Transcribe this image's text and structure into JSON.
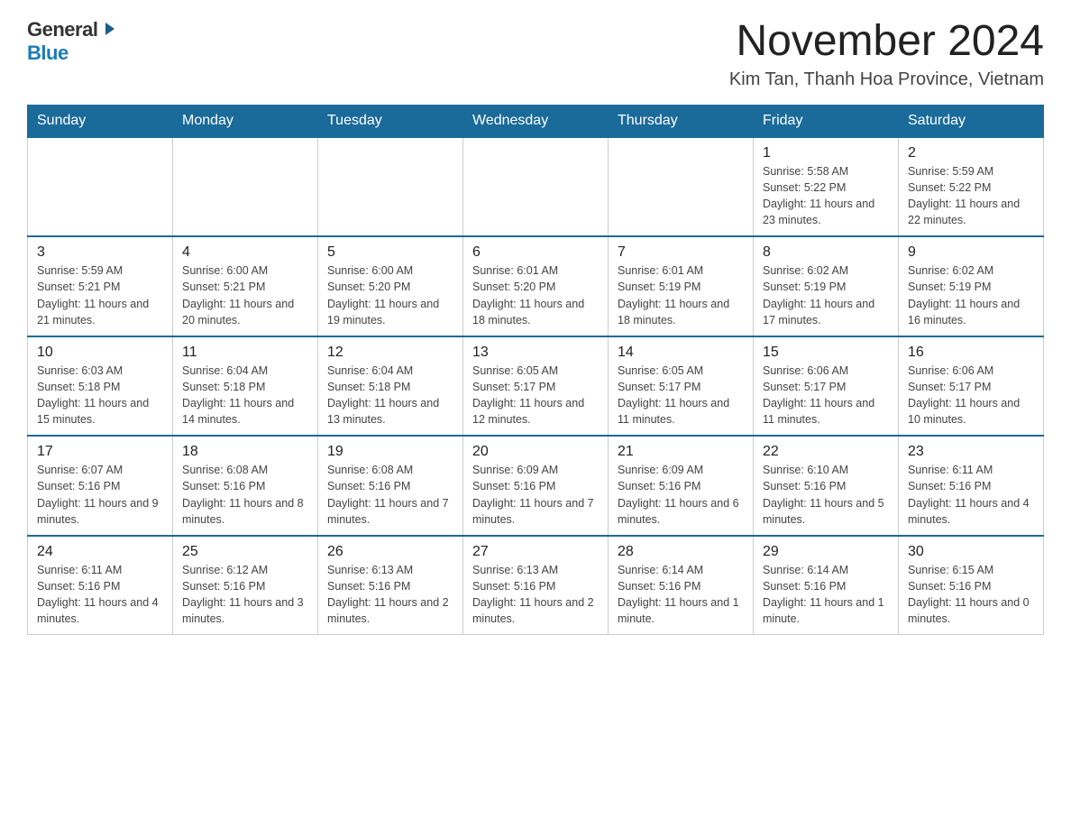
{
  "header": {
    "month_title": "November 2024",
    "location": "Kim Tan, Thanh Hoa Province, Vietnam",
    "logo_general": "General",
    "logo_blue": "Blue"
  },
  "calendar": {
    "days_of_week": [
      "Sunday",
      "Monday",
      "Tuesday",
      "Wednesday",
      "Thursday",
      "Friday",
      "Saturday"
    ],
    "weeks": [
      {
        "days": [
          {
            "num": "",
            "info": ""
          },
          {
            "num": "",
            "info": ""
          },
          {
            "num": "",
            "info": ""
          },
          {
            "num": "",
            "info": ""
          },
          {
            "num": "",
            "info": ""
          },
          {
            "num": "1",
            "info": "Sunrise: 5:58 AM\nSunset: 5:22 PM\nDaylight: 11 hours and 23 minutes."
          },
          {
            "num": "2",
            "info": "Sunrise: 5:59 AM\nSunset: 5:22 PM\nDaylight: 11 hours and 22 minutes."
          }
        ]
      },
      {
        "days": [
          {
            "num": "3",
            "info": "Sunrise: 5:59 AM\nSunset: 5:21 PM\nDaylight: 11 hours and 21 minutes."
          },
          {
            "num": "4",
            "info": "Sunrise: 6:00 AM\nSunset: 5:21 PM\nDaylight: 11 hours and 20 minutes."
          },
          {
            "num": "5",
            "info": "Sunrise: 6:00 AM\nSunset: 5:20 PM\nDaylight: 11 hours and 19 minutes."
          },
          {
            "num": "6",
            "info": "Sunrise: 6:01 AM\nSunset: 5:20 PM\nDaylight: 11 hours and 18 minutes."
          },
          {
            "num": "7",
            "info": "Sunrise: 6:01 AM\nSunset: 5:19 PM\nDaylight: 11 hours and 18 minutes."
          },
          {
            "num": "8",
            "info": "Sunrise: 6:02 AM\nSunset: 5:19 PM\nDaylight: 11 hours and 17 minutes."
          },
          {
            "num": "9",
            "info": "Sunrise: 6:02 AM\nSunset: 5:19 PM\nDaylight: 11 hours and 16 minutes."
          }
        ]
      },
      {
        "days": [
          {
            "num": "10",
            "info": "Sunrise: 6:03 AM\nSunset: 5:18 PM\nDaylight: 11 hours and 15 minutes."
          },
          {
            "num": "11",
            "info": "Sunrise: 6:04 AM\nSunset: 5:18 PM\nDaylight: 11 hours and 14 minutes."
          },
          {
            "num": "12",
            "info": "Sunrise: 6:04 AM\nSunset: 5:18 PM\nDaylight: 11 hours and 13 minutes."
          },
          {
            "num": "13",
            "info": "Sunrise: 6:05 AM\nSunset: 5:17 PM\nDaylight: 11 hours and 12 minutes."
          },
          {
            "num": "14",
            "info": "Sunrise: 6:05 AM\nSunset: 5:17 PM\nDaylight: 11 hours and 11 minutes."
          },
          {
            "num": "15",
            "info": "Sunrise: 6:06 AM\nSunset: 5:17 PM\nDaylight: 11 hours and 11 minutes."
          },
          {
            "num": "16",
            "info": "Sunrise: 6:06 AM\nSunset: 5:17 PM\nDaylight: 11 hours and 10 minutes."
          }
        ]
      },
      {
        "days": [
          {
            "num": "17",
            "info": "Sunrise: 6:07 AM\nSunset: 5:16 PM\nDaylight: 11 hours and 9 minutes."
          },
          {
            "num": "18",
            "info": "Sunrise: 6:08 AM\nSunset: 5:16 PM\nDaylight: 11 hours and 8 minutes."
          },
          {
            "num": "19",
            "info": "Sunrise: 6:08 AM\nSunset: 5:16 PM\nDaylight: 11 hours and 7 minutes."
          },
          {
            "num": "20",
            "info": "Sunrise: 6:09 AM\nSunset: 5:16 PM\nDaylight: 11 hours and 7 minutes."
          },
          {
            "num": "21",
            "info": "Sunrise: 6:09 AM\nSunset: 5:16 PM\nDaylight: 11 hours and 6 minutes."
          },
          {
            "num": "22",
            "info": "Sunrise: 6:10 AM\nSunset: 5:16 PM\nDaylight: 11 hours and 5 minutes."
          },
          {
            "num": "23",
            "info": "Sunrise: 6:11 AM\nSunset: 5:16 PM\nDaylight: 11 hours and 4 minutes."
          }
        ]
      },
      {
        "days": [
          {
            "num": "24",
            "info": "Sunrise: 6:11 AM\nSunset: 5:16 PM\nDaylight: 11 hours and 4 minutes."
          },
          {
            "num": "25",
            "info": "Sunrise: 6:12 AM\nSunset: 5:16 PM\nDaylight: 11 hours and 3 minutes."
          },
          {
            "num": "26",
            "info": "Sunrise: 6:13 AM\nSunset: 5:16 PM\nDaylight: 11 hours and 2 minutes."
          },
          {
            "num": "27",
            "info": "Sunrise: 6:13 AM\nSunset: 5:16 PM\nDaylight: 11 hours and 2 minutes."
          },
          {
            "num": "28",
            "info": "Sunrise: 6:14 AM\nSunset: 5:16 PM\nDaylight: 11 hours and 1 minute."
          },
          {
            "num": "29",
            "info": "Sunrise: 6:14 AM\nSunset: 5:16 PM\nDaylight: 11 hours and 1 minute."
          },
          {
            "num": "30",
            "info": "Sunrise: 6:15 AM\nSunset: 5:16 PM\nDaylight: 11 hours and 0 minutes."
          }
        ]
      }
    ]
  }
}
